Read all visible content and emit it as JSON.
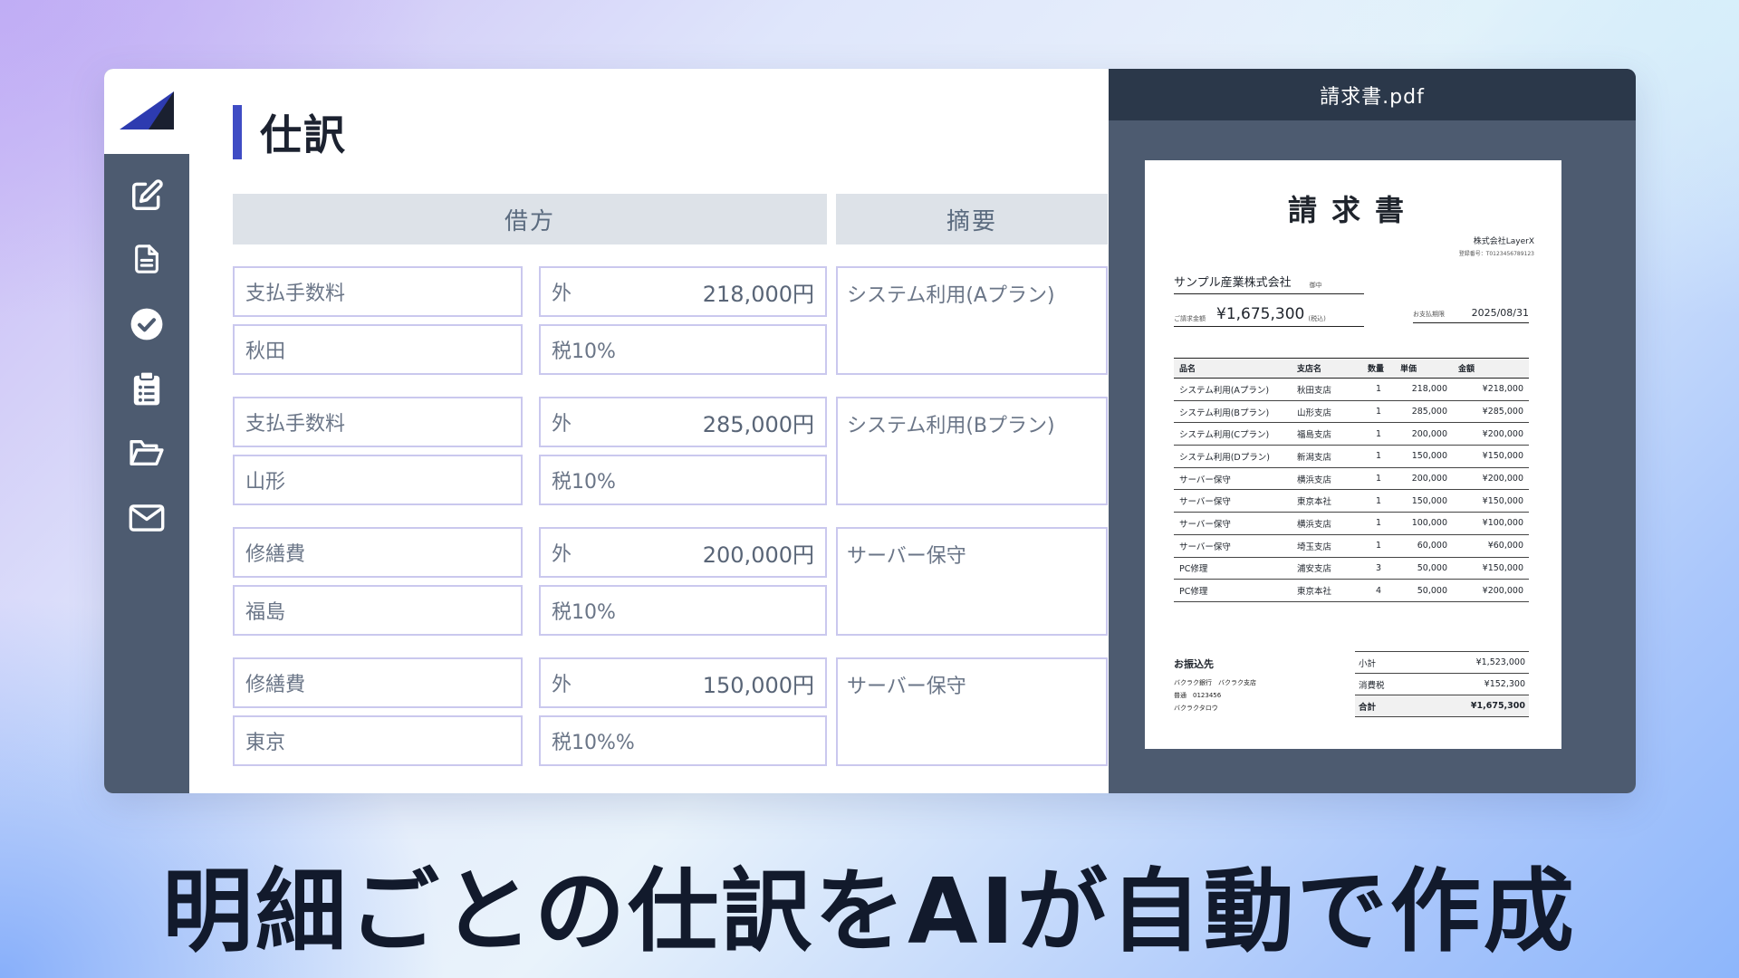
{
  "title": "仕訳",
  "columns": {
    "debit": "借方",
    "summary": "摘要"
  },
  "entries": [
    {
      "account": "支払手数料",
      "dept": "秋田",
      "tax_type": "外",
      "amount": "218,000円",
      "tax_rate": "税10%",
      "description": "システム利用(Aプラン)"
    },
    {
      "account": "支払手数料",
      "dept": "山形",
      "tax_type": "外",
      "amount": "285,000円",
      "tax_rate": "税10%",
      "description": "システム利用(Bプラン)"
    },
    {
      "account": "修繕費",
      "dept": "福島",
      "tax_type": "外",
      "amount": "200,000円",
      "tax_rate": "税10%",
      "description": "サーバー保守"
    },
    {
      "account": "修繕費",
      "dept": "東京",
      "tax_type": "外",
      "amount": "150,000円",
      "tax_rate": "税10%%",
      "description": "サーバー保守"
    }
  ],
  "sidebar": {
    "icons": [
      "edit-icon",
      "document-icon",
      "check-circle-icon",
      "clipboard-list-icon",
      "folder-open-icon",
      "mail-icon"
    ],
    "accent": "#3f4cc4"
  },
  "pdf": {
    "filename": "請求書.pdf",
    "title": "請求書",
    "issuer": "株式会社LayerX",
    "reg_no": "登録番号：T0123456789123",
    "client": "サンプル産業株式会社",
    "honorific": "御中",
    "amount_label": "ご請求金額",
    "amount": "¥1,675,300",
    "tax_incl": "(税込)",
    "due_label": "お支払期限",
    "due_date": "2025/08/31",
    "headers": [
      "品名",
      "支店名",
      "数量",
      "単価",
      "金額"
    ],
    "rows": [
      [
        "システム利用(Aプラン)",
        "秋田支店",
        "1",
        "218,000",
        "¥218,000"
      ],
      [
        "システム利用(Bプラン)",
        "山形支店",
        "1",
        "285,000",
        "¥285,000"
      ],
      [
        "システム利用(Cプラン)",
        "福島支店",
        "1",
        "200,000",
        "¥200,000"
      ],
      [
        "システム利用(Dプラン)",
        "新潟支店",
        "1",
        "150,000",
        "¥150,000"
      ],
      [
        "サーバー保守",
        "横浜支店",
        "1",
        "200,000",
        "¥200,000"
      ],
      [
        "サーバー保守",
        "東京本社",
        "1",
        "150,000",
        "¥150,000"
      ],
      [
        "サーバー保守",
        "横浜支店",
        "1",
        "100,000",
        "¥100,000"
      ],
      [
        "サーバー保守",
        "埼玉支店",
        "1",
        "60,000",
        "¥60,000"
      ],
      [
        "PC修理",
        "浦安支店",
        "3",
        "50,000",
        "¥150,000"
      ],
      [
        "PC修理",
        "東京本社",
        "4",
        "50,000",
        "¥200,000"
      ]
    ],
    "bank_title": "お振込先",
    "bank_line1": "バクラク銀行　バクラク支店",
    "bank_line2": "普通　0123456",
    "bank_line3": "バクラクタロウ",
    "totals": [
      {
        "label": "小計",
        "value": "¥1,523,000"
      },
      {
        "label": "消費税",
        "value": "¥152,300"
      },
      {
        "label": "合計",
        "value": "¥1,675,300"
      }
    ]
  },
  "caption": "明細ごとの仕訳をAIが自動で作成"
}
